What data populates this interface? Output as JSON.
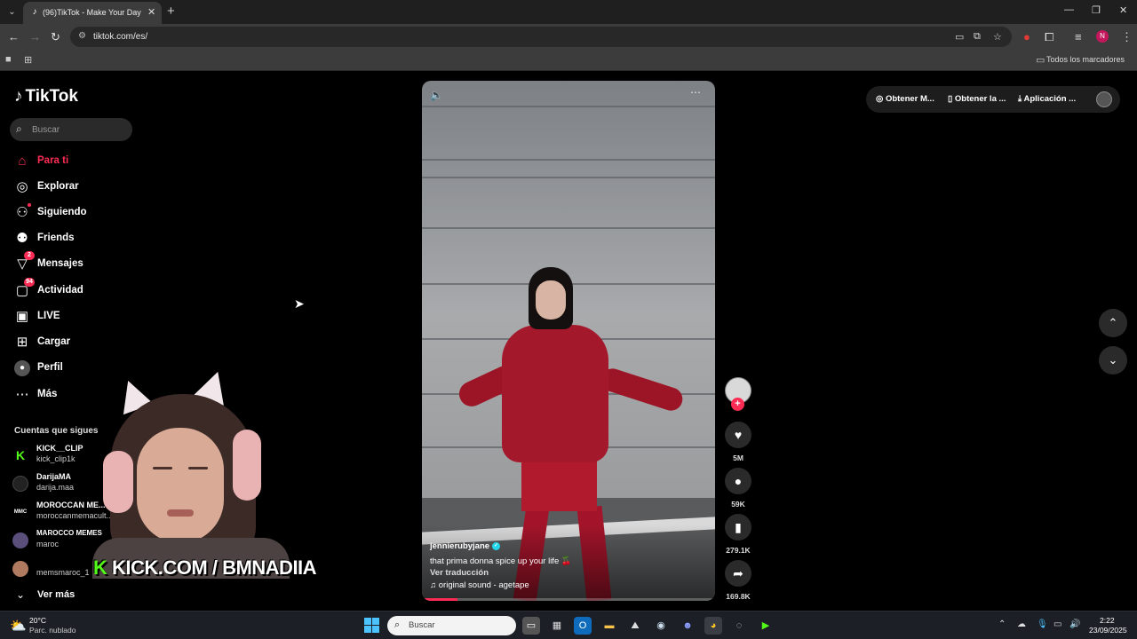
{
  "browser": {
    "tab_title": "(96)TikTok - Make Your Day",
    "url": "tiktok.com/es/",
    "bookmarks_folder": "Todos los marcadores",
    "profile_initial": "N"
  },
  "tiktok": {
    "logo_text": "TikTok",
    "search_placeholder": "Buscar",
    "nav": [
      {
        "label": "Para ti",
        "icon": "home-icon"
      },
      {
        "label": "Explorar",
        "icon": "compass-icon"
      },
      {
        "label": "Siguiendo",
        "icon": "following-icon"
      },
      {
        "label": "Friends",
        "icon": "friends-icon"
      },
      {
        "label": "Mensajes",
        "icon": "messages-icon",
        "badge": "2"
      },
      {
        "label": "Actividad",
        "icon": "activity-icon",
        "badge": "94"
      },
      {
        "label": "LIVE",
        "icon": "live-icon"
      },
      {
        "label": "Cargar",
        "icon": "upload-icon"
      },
      {
        "label": "Perfil",
        "icon": "profile-icon"
      },
      {
        "label": "Más",
        "icon": "more-icon"
      }
    ],
    "following_title": "Cuentas que sigues",
    "accounts": [
      {
        "name": "KICK__CLIP",
        "handle": "kick_clip1k"
      },
      {
        "name": "DarijaMA",
        "handle": "darija.maa"
      },
      {
        "name": "MOROCCAN ME...",
        "handle": "moroccanmemacult..."
      },
      {
        "name": "MAROCCO MEMES",
        "handle": "maroc"
      },
      {
        "name": "",
        "handle": "memsmaroc_1"
      }
    ],
    "see_more": "Ver más",
    "overlay_banner_k": "K",
    "overlay_banner": "KICK.COM / BMNADIIA",
    "video": {
      "username": "jennierubyjane",
      "caption": "that prima donna spice up your life 🍒",
      "translate": "Ver traducción",
      "sound": "original sound - agetape",
      "progress": 0.12
    },
    "actions": {
      "likes": "5M",
      "comments": "59K",
      "saves": "279.1K",
      "shares": "169.8K"
    },
    "top_pills": {
      "coins": "Obtener M...",
      "app": "Obtener la ...",
      "download": "Aplicación ..."
    }
  },
  "taskbar": {
    "temperature": "20°C",
    "weather": "Parc. nublado",
    "search_label": "Buscar",
    "time": "2:22",
    "date": "23/09/2025"
  },
  "colors": {
    "accent": "#fe2c55",
    "kick_green": "#53fc18",
    "verified": "#20d5ec"
  }
}
